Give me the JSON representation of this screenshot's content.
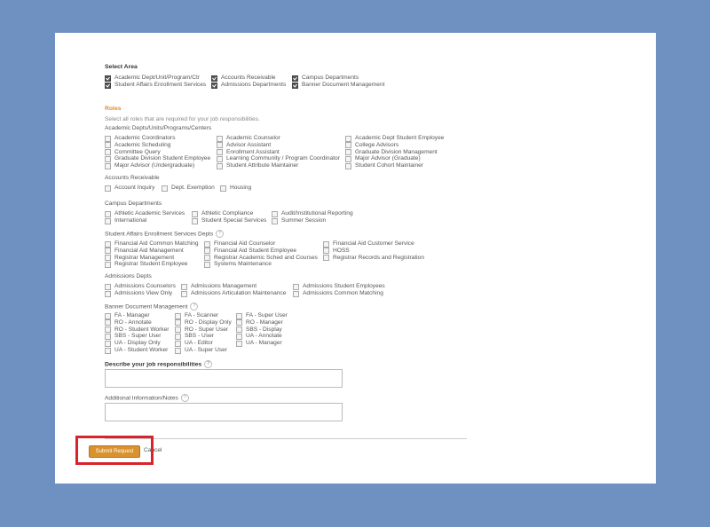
{
  "select_area": {
    "heading": "Select Area",
    "options": [
      {
        "label": "Academic Dept/Unit/Program/Ctr",
        "checked": true
      },
      {
        "label": "Accounts Receivable",
        "checked": true
      },
      {
        "label": "Campus Departments",
        "checked": true
      },
      {
        "label": "Student Affairs Enrollment Services",
        "checked": true
      },
      {
        "label": "Admissions Departments",
        "checked": true
      },
      {
        "label": "Banner Document Management",
        "checked": true
      }
    ]
  },
  "roles": {
    "heading": "Roles",
    "instruction": "Select all roles that are required for your job responsibilities.",
    "academic": {
      "heading": "Academic Depts/Units/Programs/Centers",
      "items": [
        "Academic Coordinators",
        "Academic Counselor",
        "Academic Dept Student Employee",
        "Academic Scheduling",
        "Advisor Assistant",
        "College Advisors",
        "Committee Query",
        "Enrollment Assistant",
        "Graduate Division Management",
        "Graduate Division Student Employee",
        "Learning Community / Program Coordinator",
        "Major Advisor (Graduate)",
        "Major Advisor (Undergraduate)",
        "Student Attribute Maintainer",
        "Student Cohort Maintainer"
      ]
    },
    "accounts": {
      "heading": "Accounts Receivable",
      "items": [
        "Account Inquiry",
        "Dept. Exemption",
        "Housing"
      ]
    },
    "campus": {
      "heading": "Campus Departments",
      "items": [
        "Athletic Academic Services",
        "Athletic Compliance",
        "Audit/Institutional Reporting",
        "International",
        "Student Special Services",
        "Summer Session"
      ]
    },
    "student_affairs": {
      "heading": "Student Affairs Enrollment Services Depts",
      "help": "?",
      "items": [
        "Financial Aid Common Matching",
        "Financial Aid Counselor",
        "Financial Aid Customer Service",
        "Financial Aid Management",
        "Financial Aid Student Employee",
        "HOSS",
        "Registrar Management",
        "Registrar Academic Sched and Courses",
        "Registrar Records and Registration",
        "Registrar Student Employee",
        "Systems Maintenance"
      ]
    },
    "admissions": {
      "heading": "Admissions Depts",
      "items": [
        "Admissions Counselors",
        "Admissions Management",
        "Admissions Student Employees",
        "Admissions View Only",
        "Admissions Articulation Maintenance",
        "Admissions Common Matching"
      ]
    },
    "banner": {
      "heading": "Banner Document Management",
      "help": "?",
      "col1": [
        "FA - Manager",
        "RO - Annotate",
        "RO - Student Worker",
        "SBS - Super User",
        "UA - Display Only",
        "UA - Student Worker"
      ],
      "col2": [
        "FA - Scanner",
        "RO - Display Only",
        "RO - Super User",
        "SBS - User",
        "UA - Editor",
        "UA - Super User"
      ],
      "col3": [
        "FA - Super User",
        "RO - Manager",
        "SBS - Display",
        "UA - Annotate",
        "UA - Manager"
      ]
    }
  },
  "job": {
    "label": "Describe your job responsibilities",
    "help": "?",
    "value": ""
  },
  "notes": {
    "label": "Additional Information/Notes",
    "help": "?",
    "value": ""
  },
  "actions": {
    "submit_label": "Submit Request",
    "cancel_label": "Cancel"
  }
}
